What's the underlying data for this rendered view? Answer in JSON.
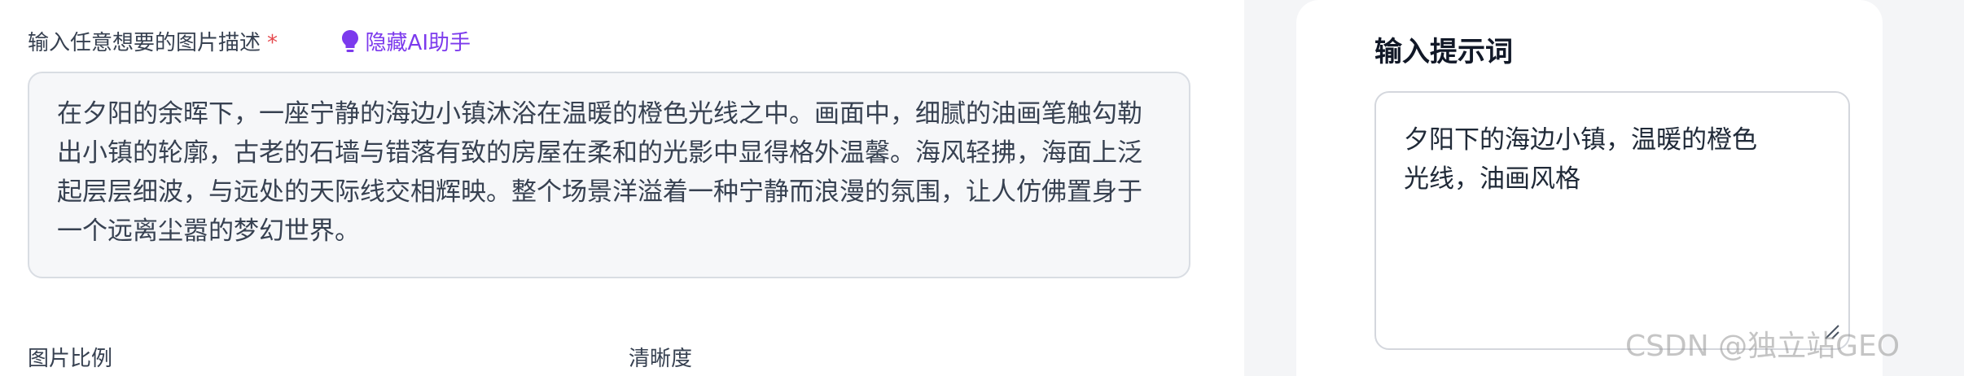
{
  "left": {
    "description_label": "输入任意想要的图片描述",
    "required_mark": "*",
    "ai_toggle_label": "隐藏AI助手",
    "description_text": "在夕阳的余晖下，一座宁静的海边小镇沐浴在温暖的橙色光线之中。画面中，细腻的油画笔触勾勒出小镇的轮廓，古老的石墙与错落有致的房屋在柔和的光影中显得格外温馨。海风轻拂，海面上泛起层层细波，与远处的天际线交相辉映。整个场景洋溢着一种宁静而浪漫的氛围，让人仿佛置身于一个远离尘嚣的梦幻世界。",
    "ratio_label": "图片比例",
    "clarity_label": "清晰度"
  },
  "prompt_panel": {
    "title": "输入提示词",
    "prompt_text": "夕阳下的海边小镇，温暖的橙色光线，油画风格"
  },
  "watermark": "CSDN @独立站GEO",
  "colors": {
    "accent": "#7c3aed",
    "required": "#e5484d"
  },
  "icons": {
    "ai_toggle": "lightbulb-icon",
    "resize": "resize-handle-icon"
  }
}
